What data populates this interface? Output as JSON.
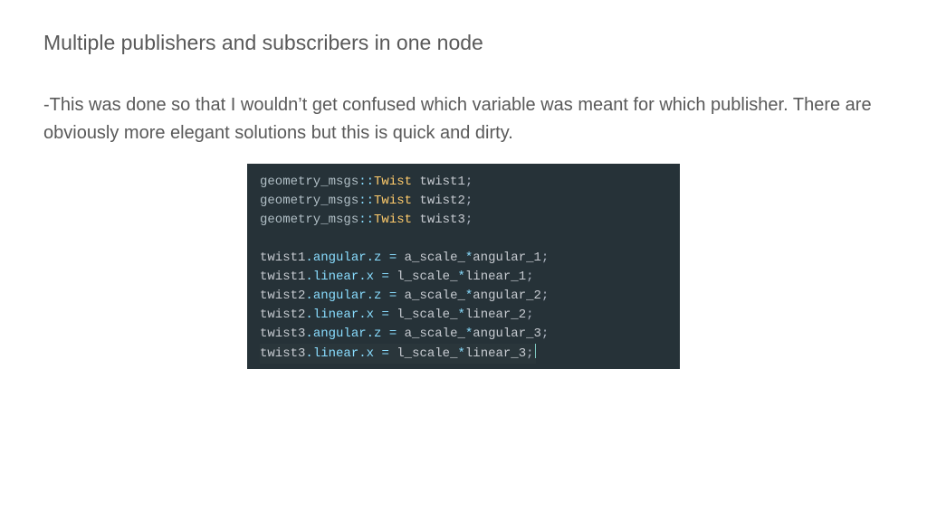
{
  "title": "Multiple publishers and subscribers in one node",
  "body": "-This was done so that I wouldn’t get confused which variable was meant for which publisher. There are obviously more elegant solutions but this is quick and dirty.",
  "code": {
    "decl_type": "geometry_msgs",
    "decl_sep": "::",
    "decl_class": "Twist",
    "decl_vars": [
      "twist1",
      "twist2",
      "twist3"
    ],
    "assigns": [
      {
        "obj": "twist1",
        "chain": ".angular.z",
        "op": " = ",
        "rhs1": "a_scale_",
        "mul": "*",
        "rhs2": "angular_1",
        "semi": ";"
      },
      {
        "obj": "twist1",
        "chain": ".linear.x",
        "op": " = ",
        "rhs1": "l_scale_",
        "mul": "*",
        "rhs2": "linear_1",
        "semi": ";"
      },
      {
        "obj": "twist2",
        "chain": ".angular.z",
        "op": " = ",
        "rhs1": "a_scale_",
        "mul": "*",
        "rhs2": "angular_2",
        "semi": ";"
      },
      {
        "obj": "twist2",
        "chain": ".linear.x",
        "op": " = ",
        "rhs1": "l_scale_",
        "mul": "*",
        "rhs2": "linear_2",
        "semi": ";"
      },
      {
        "obj": "twist3",
        "chain": ".angular.z",
        "op": " = ",
        "rhs1": "a_scale_",
        "mul": "*",
        "rhs2": "angular_3",
        "semi": ";"
      },
      {
        "obj": "twist3",
        "chain": ".linear.x",
        "op": " = ",
        "rhs1": "l_scale_",
        "mul": "*",
        "rhs2": "linear_3",
        "semi": ";"
      }
    ],
    "semi": ";"
  }
}
